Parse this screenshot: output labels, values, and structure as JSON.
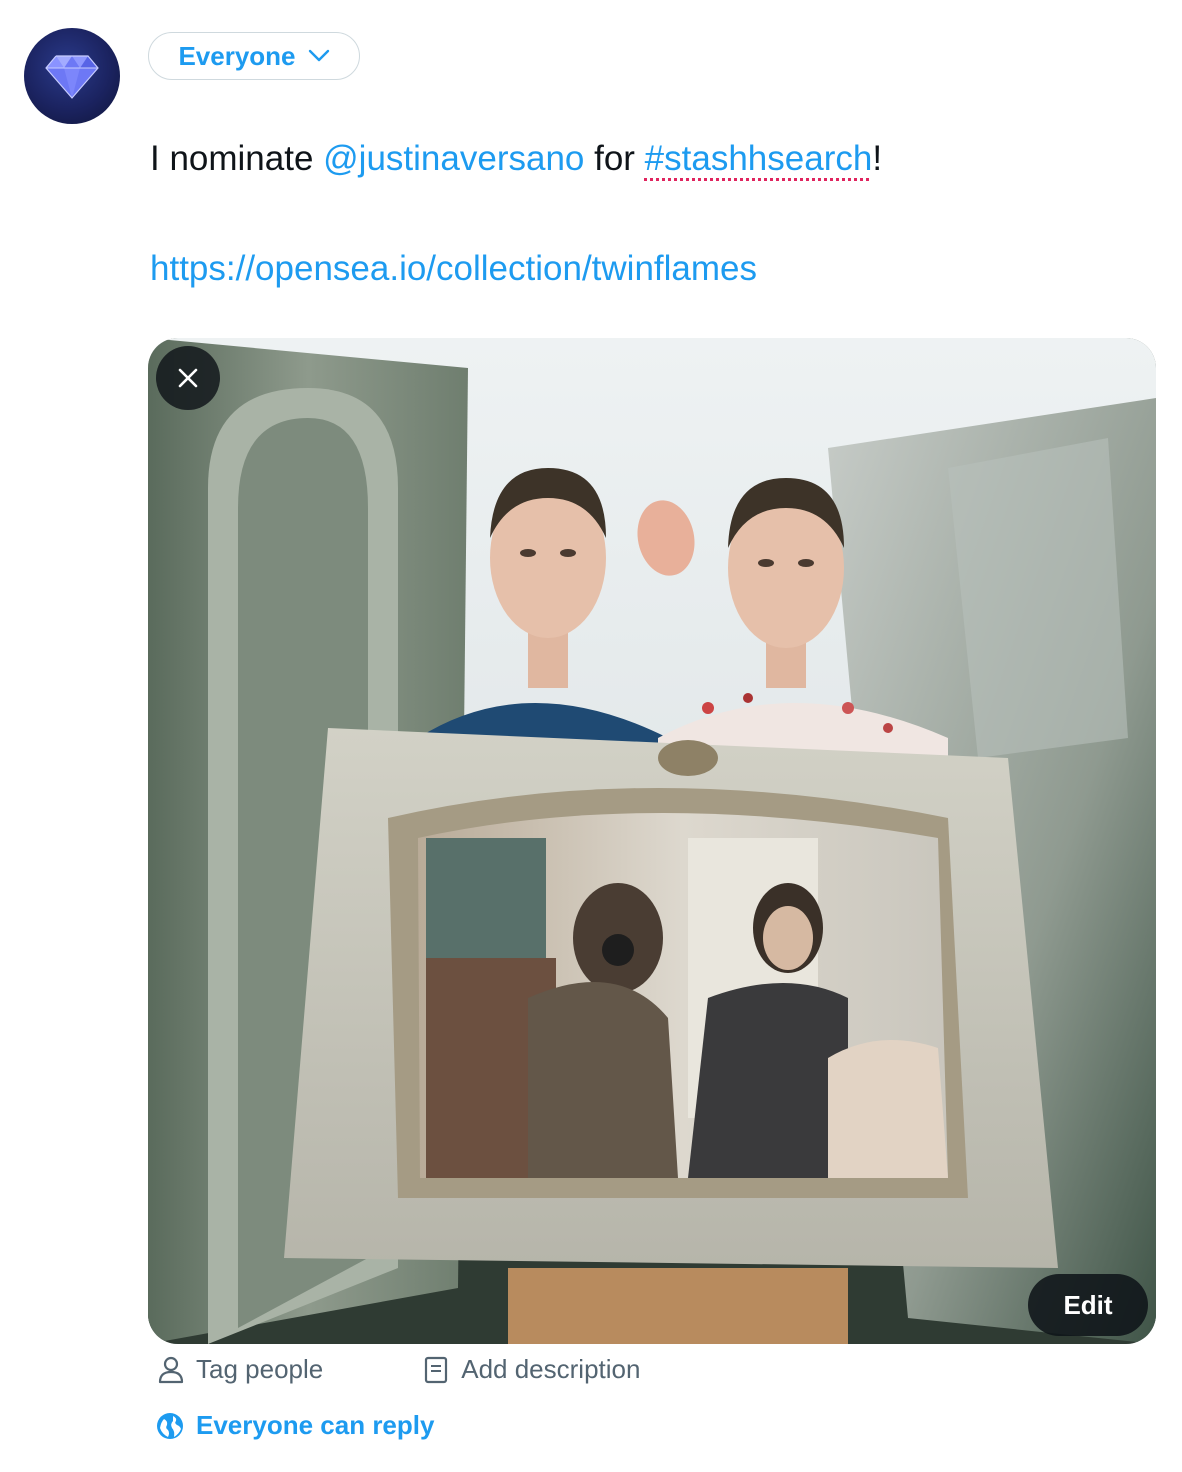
{
  "composer": {
    "audience_label": "Everyone",
    "audience_icon": "chevron-down-icon",
    "avatar_icon": "diamond-icon",
    "text": {
      "prefix": "I nominate ",
      "mention": "@justinaversano",
      "middle": " for ",
      "hashtag": "#stashhsearch",
      "suffix": "!",
      "link": "https://opensea.io/collection/twinflames"
    },
    "media": {
      "close_icon": "close-icon",
      "edit_label": "Edit"
    },
    "media_actions": {
      "tag_people_label": "Tag people",
      "tag_people_icon": "person-icon",
      "add_description_label": "Add description",
      "add_description_icon": "document-icon"
    },
    "reply_setting": {
      "label": "Everyone can reply",
      "icon": "globe-icon"
    },
    "colors": {
      "accent": "#1d9bf0",
      "text": "#0f1419",
      "secondary": "#536471",
      "spellcheck": "#e0245e"
    }
  }
}
